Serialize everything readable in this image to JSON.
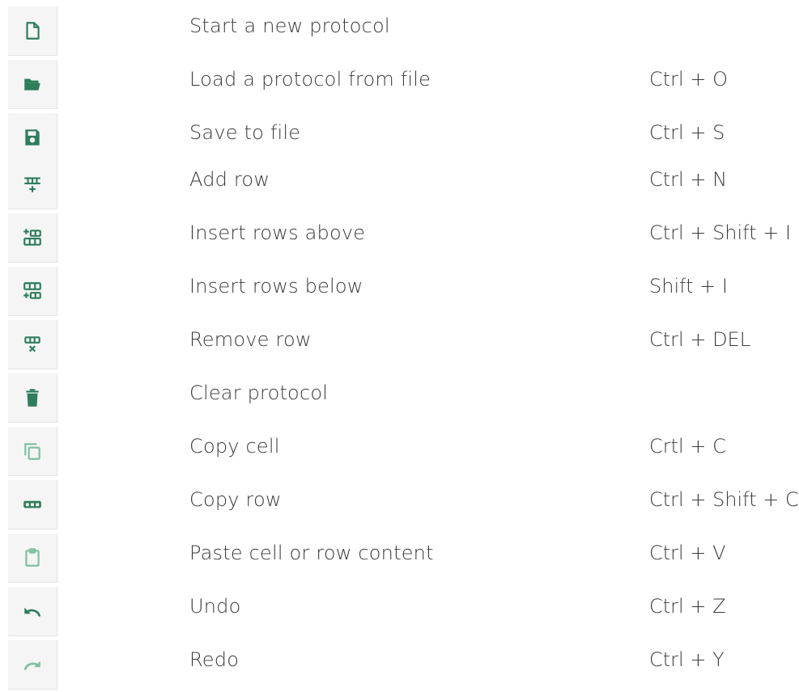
{
  "colors": {
    "icon_dark": "#2e7d5b",
    "icon_light": "#7fbf9f",
    "icon_bg": "#f5f5f5",
    "text": "#3a3a3a"
  },
  "items": [
    {
      "icon": "new-file-icon",
      "label": "Start a new protocol",
      "shortcut": ""
    },
    {
      "icon": "folder-open-icon",
      "label": "Load a protocol from file",
      "shortcut": "Ctrl + O"
    },
    {
      "icon": "save-icon",
      "label": "Save to file",
      "shortcut": "Ctrl + S"
    },
    {
      "icon": "add-row-icon",
      "label": "Add row",
      "shortcut": " Ctrl + N"
    },
    {
      "icon": "insert-rows-above-icon",
      "label": "Insert rows above",
      "shortcut": "Ctrl + Shift + I"
    },
    {
      "icon": "insert-rows-below-icon",
      "label": "Insert rows below",
      "shortcut": "Shift + I"
    },
    {
      "icon": "remove-row-icon",
      "label": "Remove row",
      "shortcut": "Ctrl + DEL"
    },
    {
      "icon": "trash-icon",
      "label": "Clear protocol",
      "shortcut": ""
    },
    {
      "icon": "copy-cell-icon",
      "label": "Copy cell",
      "shortcut": "Crtl + C"
    },
    {
      "icon": "copy-row-icon",
      "label": "Copy row",
      "shortcut": "Ctrl + Shift + C"
    },
    {
      "icon": "clipboard-icon",
      "label": "Paste cell or row content",
      "shortcut": "Ctrl + V"
    },
    {
      "icon": "undo-icon",
      "label": "Undo",
      "shortcut": "Ctrl + Z"
    },
    {
      "icon": "redo-icon",
      "label": "Redo",
      "shortcut": "Ctrl + Y"
    }
  ]
}
